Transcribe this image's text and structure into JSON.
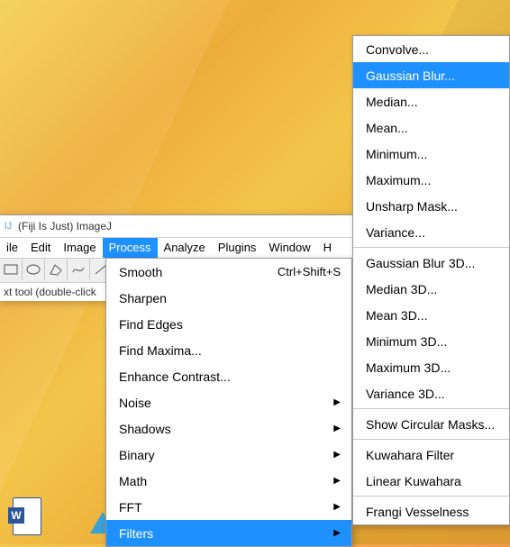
{
  "desktop": {
    "icons": {
      "word": "word-doc-icon",
      "polygon": "blue-polygon-icon"
    }
  },
  "window": {
    "logo_char": "IJ",
    "title": "(Fiji Is Just) ImageJ",
    "menubar": {
      "items": [
        "ile",
        "Edit",
        "Image",
        "Process",
        "Analyze",
        "Plugins",
        "Window",
        "H"
      ],
      "active_index": 3
    },
    "toolbar": {
      "tools": [
        "rectangle",
        "oval",
        "polygon",
        "freehand",
        "straight-line"
      ]
    },
    "status_text": "xt tool (double-click "
  },
  "process_menu": {
    "items": [
      {
        "label": "Smooth",
        "shortcut": "Ctrl+Shift+S"
      },
      {
        "label": "Sharpen"
      },
      {
        "label": "Find Edges"
      },
      {
        "label": "Find Maxima..."
      },
      {
        "label": "Enhance Contrast..."
      },
      {
        "label": "Noise",
        "submenu": true
      },
      {
        "label": "Shadows",
        "submenu": true
      },
      {
        "label": "Binary",
        "submenu": true
      },
      {
        "label": "Math",
        "submenu": true
      },
      {
        "label": "FFT",
        "submenu": true
      },
      {
        "label": "Filters",
        "submenu": true,
        "highlighted": true
      }
    ]
  },
  "filters_submenu": {
    "items": [
      {
        "label": "Convolve..."
      },
      {
        "label": "Gaussian Blur...",
        "highlighted": true
      },
      {
        "label": "Median..."
      },
      {
        "label": "Mean..."
      },
      {
        "label": "Minimum..."
      },
      {
        "label": "Maximum..."
      },
      {
        "label": "Unsharp Mask..."
      },
      {
        "label": "Variance..."
      },
      {
        "sep": true
      },
      {
        "label": "Gaussian Blur 3D..."
      },
      {
        "label": "Median 3D..."
      },
      {
        "label": "Mean 3D..."
      },
      {
        "label": "Minimum 3D..."
      },
      {
        "label": "Maximum 3D..."
      },
      {
        "label": "Variance 3D..."
      },
      {
        "sep": true
      },
      {
        "label": "Show Circular Masks..."
      },
      {
        "sep": true
      },
      {
        "label": "Kuwahara Filter"
      },
      {
        "label": "Linear Kuwahara"
      },
      {
        "sep": true
      },
      {
        "label": "Frangi Vesselness"
      }
    ]
  }
}
